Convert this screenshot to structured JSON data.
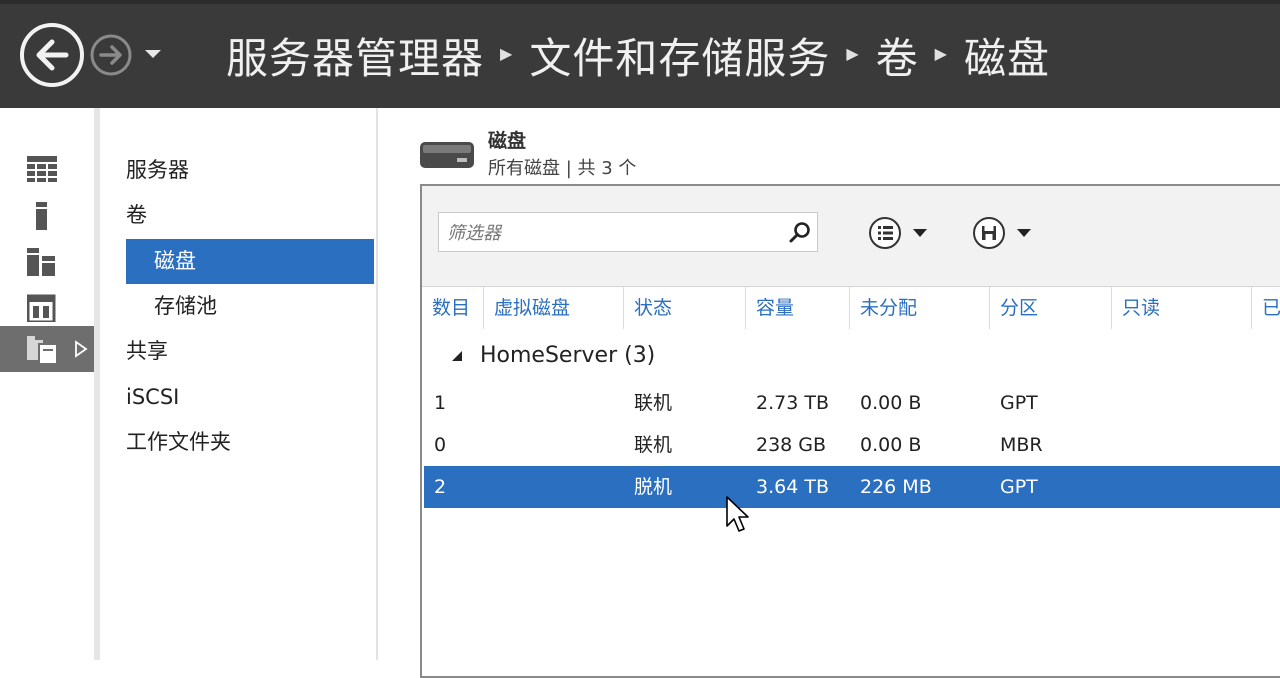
{
  "header": {
    "breadcrumb": [
      "服务器管理器",
      "文件和存储服务",
      "卷",
      "磁盘"
    ]
  },
  "icons": {
    "back": "back-arrow-icon",
    "forward": "forward-arrow-icon",
    "history": "chevron-down-icon"
  },
  "rail": {
    "items": [
      "dashboard-icon",
      "local-server-icon",
      "all-servers-icon",
      "roles-icon",
      "file-storage-icon"
    ],
    "active_index": 4
  },
  "tree": {
    "items": [
      {
        "label": "服务器",
        "level": 0
      },
      {
        "label": "卷",
        "level": 0
      },
      {
        "label": "磁盘",
        "level": 1,
        "selected": true
      },
      {
        "label": "存储池",
        "level": 1
      },
      {
        "label": "共享",
        "level": 0
      },
      {
        "label": "iSCSI",
        "level": 0
      },
      {
        "label": "工作文件夹",
        "level": 0
      }
    ]
  },
  "content": {
    "title": "磁盘",
    "subtitle": "所有磁盘 | 共 3 个"
  },
  "toolbar": {
    "filter_placeholder": "筛选器"
  },
  "table": {
    "columns": [
      "数目",
      "虚拟磁盘",
      "状态",
      "容量",
      "未分配",
      "分区",
      "只读",
      "已"
    ],
    "group": "HomeServer (3)",
    "rows": [
      {
        "number": "1",
        "virtual": "",
        "status": "联机",
        "capacity": "2.73 TB",
        "unallocated": "0.00 B",
        "partition": "GPT",
        "readonly": ""
      },
      {
        "number": "0",
        "virtual": "",
        "status": "联机",
        "capacity": "238 GB",
        "unallocated": "0.00 B",
        "partition": "MBR",
        "readonly": ""
      },
      {
        "number": "2",
        "virtual": "",
        "status": "脱机",
        "capacity": "3.64 TB",
        "unallocated": "226 MB",
        "partition": "GPT",
        "readonly": "",
        "selected": true
      }
    ]
  },
  "colors": {
    "header_bg": "#3a3a3a",
    "accent": "#2b6fc0",
    "rail_active": "#6e6e6e"
  }
}
